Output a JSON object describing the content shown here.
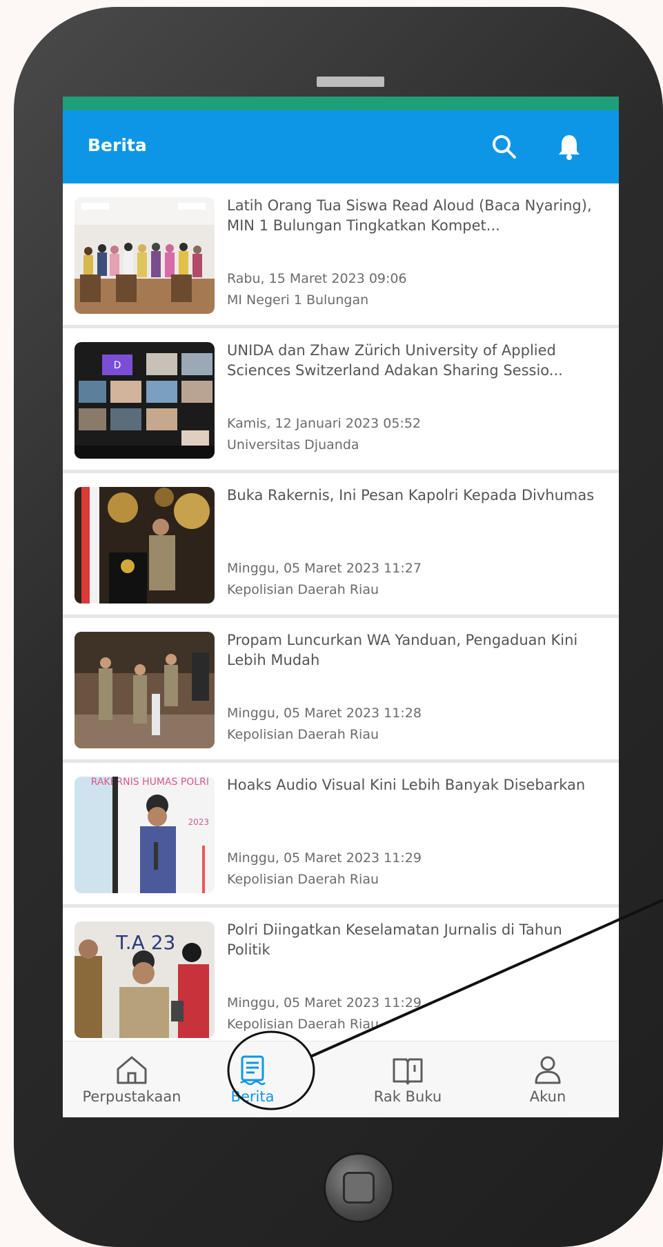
{
  "app": {
    "title": "Berita"
  },
  "header": {
    "title": "Berita",
    "search_icon": "search-icon",
    "notification_icon": "bell-icon"
  },
  "news": [
    {
      "title": "Latih Orang Tua Siswa Read Aloud (Baca Nyaring), MIN 1 Bulungan Tingkatkan Kompet...",
      "date": "Rabu, 15 Maret 2023 09:06",
      "source": "MI Negeri 1 Bulungan"
    },
    {
      "title": "UNIDA dan Zhaw Zürich University of Applied Sciences Switzerland Adakan Sharing Sessio...",
      "date": "Kamis, 12 Januari 2023 05:52",
      "source": "Universitas Djuanda"
    },
    {
      "title": "Buka Rakernis, Ini Pesan Kapolri Kepada Divhumas",
      "date": "Minggu, 05 Maret 2023 11:27",
      "source": "Kepolisian Daerah Riau"
    },
    {
      "title": "Propam Luncurkan WA Yanduan, Pengaduan Kini Lebih Mudah",
      "date": "Minggu, 05 Maret 2023 11:28",
      "source": "Kepolisian Daerah Riau"
    },
    {
      "title": "Hoaks Audio Visual Kini Lebih Banyak Disebarkan",
      "date": "Minggu, 05 Maret 2023 11:29",
      "source": "Kepolisian Daerah Riau"
    },
    {
      "title": "Polri Diingatkan Keselamatan Jurnalis di Tahun Politik",
      "date": "Minggu, 05 Maret 2023 11:29",
      "source": "Kepolisian Daerah Riau"
    }
  ],
  "thumb_texts": {
    "rakernis_banner": "RAKERNIS HUMAS POLRI",
    "rakernis_year": "2023",
    "stage_banner": "T.A 23",
    "meeting_tile": "D"
  },
  "bottom_nav": {
    "items": [
      {
        "label": "Perpustakaan",
        "icon": "home-icon",
        "active": false
      },
      {
        "label": "Berita",
        "icon": "news-icon",
        "active": true
      },
      {
        "label": "Rak Buku",
        "icon": "book-icon",
        "active": false
      },
      {
        "label": "Akun",
        "icon": "user-icon",
        "active": false
      }
    ]
  },
  "colors": {
    "appbar": "#0e96e6",
    "statusbar": "#1f9e7a",
    "active_nav": "#0e96e6"
  }
}
